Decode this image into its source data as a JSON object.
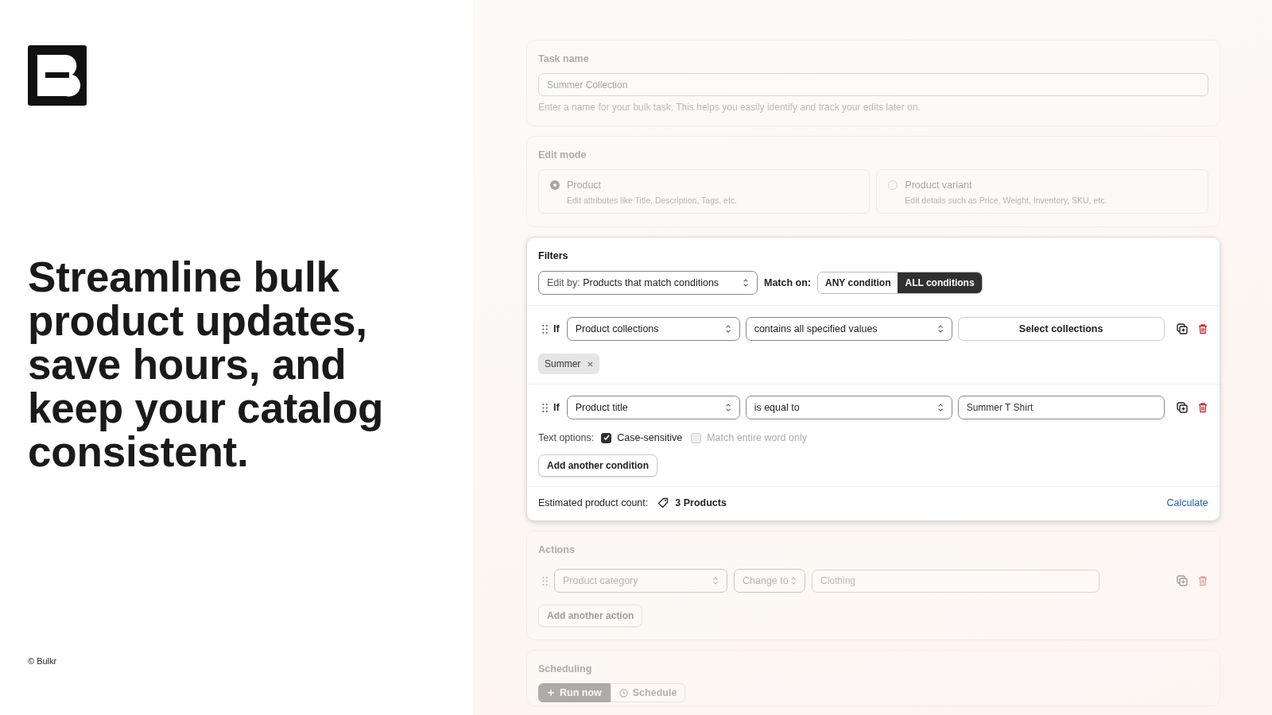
{
  "brand": {
    "tagline": "Streamline bulk product updates, save hours, and keep your catalog consistent.",
    "copyright": "© Bulkr"
  },
  "task_name": {
    "label": "Task name",
    "value": "Summer Collection",
    "help": "Enter a name for your bulk task. This helps you easily identify and track your edits later on."
  },
  "edit_mode": {
    "label": "Edit mode",
    "options": [
      {
        "title": "Product",
        "description": "Edit attributes like Title, Description, Tags, etc.",
        "selected": true
      },
      {
        "title": "Product variant",
        "description": "Edit details such as Price, Weight, Inventory, SKU, etc.",
        "selected": false
      }
    ]
  },
  "filters": {
    "title": "Filters",
    "edit_by_prefix": "Edit by:",
    "edit_by": "Products that match conditions",
    "match_label": "Match on:",
    "match_options": [
      {
        "label": "ANY condition",
        "selected": false
      },
      {
        "label": "ALL conditions",
        "selected": true
      }
    ],
    "conditions": [
      {
        "kind": "collection",
        "if": "If",
        "field": "Product collections",
        "operator": "contains all specified values",
        "button": "Select collections",
        "tags": [
          "Summer"
        ]
      },
      {
        "kind": "text",
        "if": "If",
        "field": "Product title",
        "operator": "is equal to",
        "value": "Summer T Shirt",
        "options_label": "Text options:",
        "options": [
          {
            "label": "Case-sensitive",
            "checked": true,
            "disabled": false
          },
          {
            "label": "Match entire word only",
            "checked": false,
            "disabled": true
          }
        ]
      }
    ],
    "add_button": "Add another condition",
    "count_label": "Estimated product count:",
    "count": "3 Products",
    "calculate": "Calculate"
  },
  "actions": {
    "title": "Actions",
    "rows": [
      {
        "field": "Product category",
        "operation": "Change to",
        "value": "Clothing"
      }
    ],
    "add_button": "Add another action"
  },
  "scheduling": {
    "title": "Scheduling",
    "options": [
      {
        "kind": "run",
        "label": "Run now",
        "selected": true
      },
      {
        "kind": "schedule",
        "label": "Schedule",
        "selected": false
      }
    ]
  }
}
